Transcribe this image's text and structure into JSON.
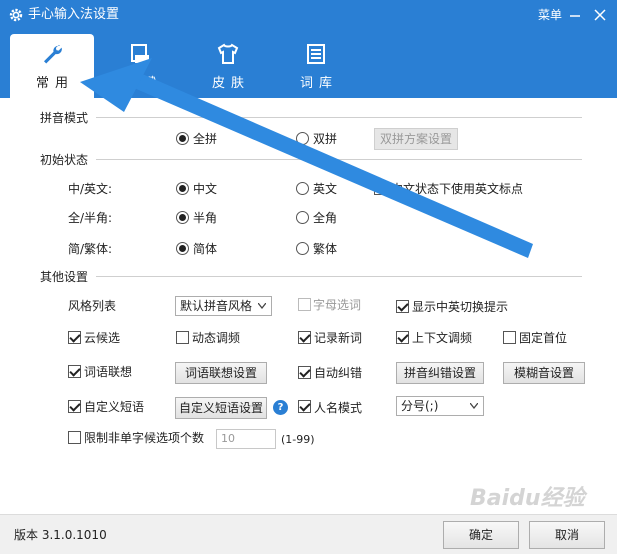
{
  "window": {
    "title": "手心输入法设置",
    "menu_label": "菜单"
  },
  "tabs": [
    {
      "label": "常用",
      "icon": "wrench-icon",
      "active": true
    },
    {
      "label": "按键",
      "icon": "keyboard-icon",
      "active": false
    },
    {
      "label": "皮肤",
      "icon": "shirt-icon",
      "active": false
    },
    {
      "label": "词库",
      "icon": "document-icon",
      "active": false
    }
  ],
  "pinyin_mode": {
    "section_title": "拼音模式",
    "full_pinyin_label": "全拼",
    "full_pinyin_selected": true,
    "double_pinyin_label": "双拼",
    "double_pinyin_selected": false,
    "double_scheme_button": "双拼方案设置"
  },
  "initial_state": {
    "section_title": "初始状态",
    "rows": [
      {
        "label": "中/英文:",
        "opt1": "中文",
        "opt1_on": true,
        "opt2": "英文",
        "opt2_on": false
      },
      {
        "label": "全/半角:",
        "opt1": "半角",
        "opt1_on": true,
        "opt2": "全角",
        "opt2_on": false
      },
      {
        "label": "简/繁体:",
        "opt1": "简体",
        "opt1_on": true,
        "opt2": "繁体",
        "opt2_on": false
      }
    ],
    "english_punct_label": "中文状态下使用英文标点",
    "english_punct_checked": false
  },
  "other": {
    "section_title": "其他设置",
    "style_list_label": "风格列表",
    "style_list_value": "默认拼音风格",
    "letter_select_label": "字母选词",
    "letter_select_checked": false,
    "show_switch_tip_label": "显示中英切换提示",
    "show_switch_tip_checked": true,
    "cloud_candidate_label": "云候选",
    "cloud_candidate_checked": true,
    "dynamic_freq_label": "动态调频",
    "dynamic_freq_checked": false,
    "record_new_label": "记录新词",
    "record_new_checked": true,
    "context_freq_label": "上下文调频",
    "context_freq_checked": true,
    "fixed_first_label": "固定首位",
    "fixed_first_checked": false,
    "word_assoc_label": "词语联想",
    "word_assoc_checked": true,
    "word_assoc_button": "词语联想设置",
    "auto_correct_label": "自动纠错",
    "auto_correct_checked": true,
    "pinyin_correct_button": "拼音纠错设置",
    "fuzzy_button": "模糊音设置",
    "custom_phrase_label": "自定义短语",
    "custom_phrase_checked": true,
    "custom_phrase_button": "自定义短语设置",
    "name_mode_label": "人名模式",
    "name_mode_checked": true,
    "name_mode_value": "分号(;)",
    "limit_label": "限制非单字候选项个数",
    "limit_checked": false,
    "limit_value": "10",
    "limit_range": "(1-99)"
  },
  "footer": {
    "version": "版本 3.1.0.1010",
    "ok_label": "确定",
    "cancel_label": "取消"
  },
  "watermark": "Baidu经验",
  "colors": {
    "accent": "#2a7fd4",
    "annotation_arrow": "#2f8ae0"
  }
}
